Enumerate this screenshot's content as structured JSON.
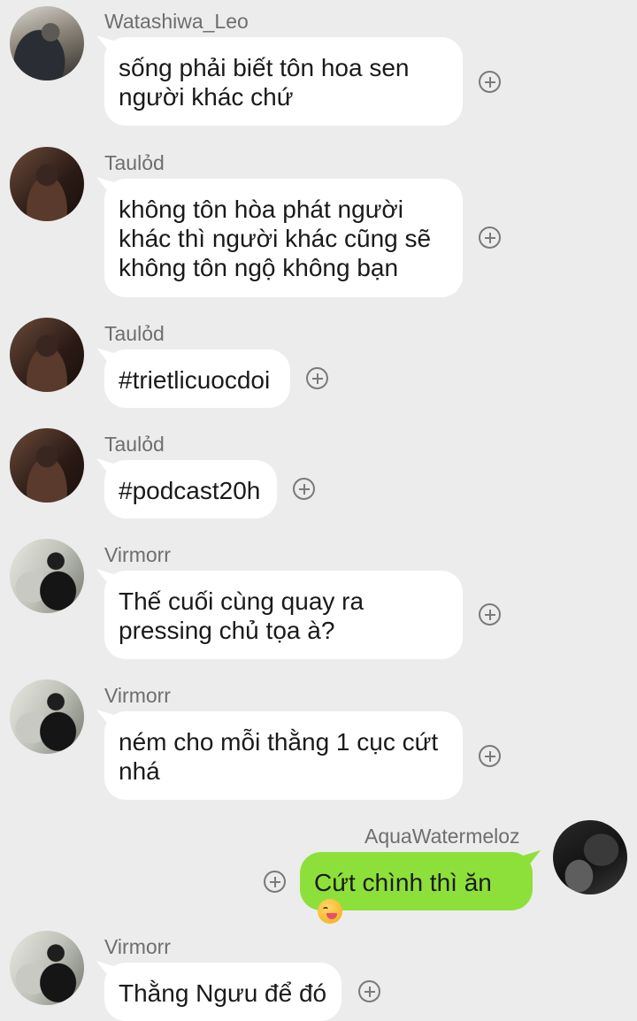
{
  "messages": [
    {
      "sender": "Watashiwa_Leo",
      "lines": [
        "sống phải biết tôn hoa sen",
        "người khác chứ"
      ]
    },
    {
      "sender": "Taulỏd",
      "lines": [
        "không tôn hòa phát người",
        "khác thì người khác cũng sẽ",
        "không tôn ngộ không bạn"
      ]
    },
    {
      "sender": "Taulỏd",
      "lines": [
        "#trietlicuocdoi"
      ]
    },
    {
      "sender": "Taulỏd",
      "lines": [
        "#podcast20h"
      ]
    },
    {
      "sender": "Virmorr",
      "lines": [
        "Thế cuối cùng quay ra",
        "pressing chủ tọa à?"
      ]
    },
    {
      "sender": "Virmorr",
      "lines": [
        "ném cho mỗi thằng 1 cục cứt",
        "nhá"
      ]
    },
    {
      "sender": "AquaWatermeloz",
      "lines": [
        "Cứt chình thì ăn"
      ],
      "emoji": "face-savoring-food",
      "own": true
    },
    {
      "sender": "Virmorr",
      "lines": [
        "Thằng Ngưu để đó"
      ]
    }
  ],
  "colors": {
    "background": "#ececec",
    "incoming_bubble": "#ffffff",
    "outgoing_bubble": "#8de03a",
    "sender_name": "#6e6e6e"
  },
  "icons": {
    "reaction": "add-reaction-icon",
    "avatar": "avatar"
  }
}
